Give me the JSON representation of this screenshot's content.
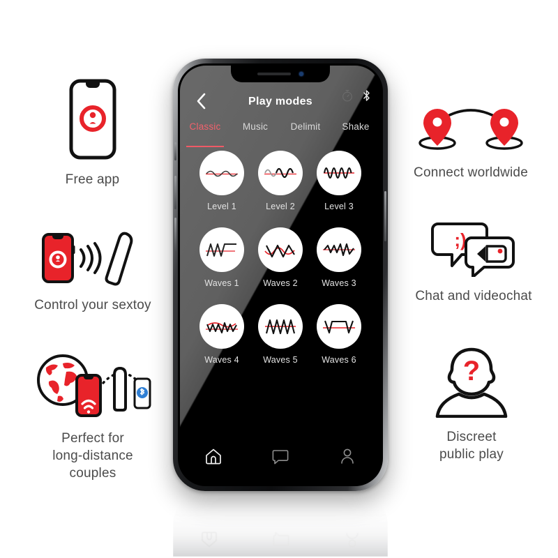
{
  "brand": {
    "red": "#e8232a",
    "accent_pink": "#ef5a66",
    "blue": "#2f7fd4",
    "caption_gray": "#4b4b4b"
  },
  "features_left": [
    {
      "id": "free-app",
      "caption": "Free app",
      "icon": "phone-with-app-logo-icon"
    },
    {
      "id": "control-sextoy",
      "caption": "Control your sextoy",
      "icon": "phone-signal-toy-icon"
    },
    {
      "id": "long-distance",
      "caption": "Perfect for\nlong-distance\ncouples",
      "icon": "globe-phone-bluetooth-icon"
    }
  ],
  "features_right": [
    {
      "id": "connect-worldwide",
      "caption": "Connect worldwide",
      "icon": "two-map-pins-icon"
    },
    {
      "id": "chat-videochat",
      "caption": "Chat and videochat",
      "icon": "speech-bubbles-icon",
      "emoticon": ";)"
    },
    {
      "id": "discreet-public-play",
      "caption": "Discreet\npublic play",
      "icon": "anonymous-person-icon"
    }
  ],
  "phone": {
    "header": {
      "title": "Play modes",
      "back_label": "Back",
      "status_icons": [
        "stopwatch-icon",
        "bluetooth-icon"
      ]
    },
    "tabs": [
      {
        "label": "Classic",
        "active": true
      },
      {
        "label": "Music",
        "active": false
      },
      {
        "label": "Delimit",
        "active": false
      },
      {
        "label": "Shake",
        "active": false
      }
    ],
    "modes": [
      {
        "label": "Level 1",
        "wave": "sine-low"
      },
      {
        "label": "Level 2",
        "wave": "sine-mid"
      },
      {
        "label": "Level 3",
        "wave": "sine-high"
      },
      {
        "label": "Waves 1",
        "wave": "saw-then-flat"
      },
      {
        "label": "Waves 2",
        "wave": "triangle-wide"
      },
      {
        "label": "Waves 3",
        "wave": "zigzag-dense"
      },
      {
        "label": "Waves 4",
        "wave": "zigzag-mixed"
      },
      {
        "label": "Waves 5",
        "wave": "triangle-dense"
      },
      {
        "label": "Waves 6",
        "wave": "square-pulse"
      }
    ],
    "nav": [
      {
        "label": "Home",
        "icon": "home-icon",
        "active": true
      },
      {
        "label": "Chat",
        "icon": "chat-bubble-icon",
        "active": false
      },
      {
        "label": "Profile",
        "icon": "person-icon",
        "active": false
      }
    ]
  }
}
